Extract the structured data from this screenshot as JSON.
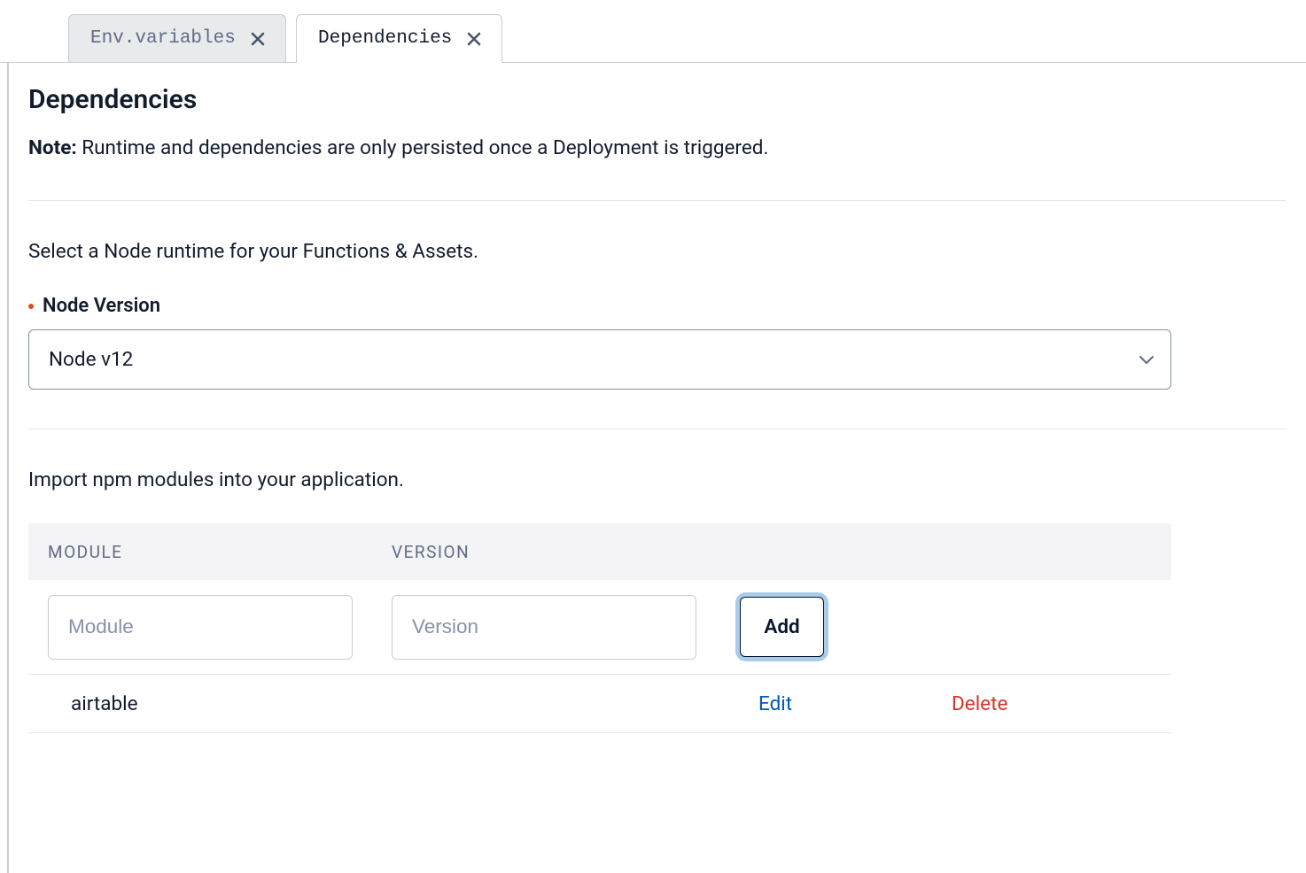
{
  "tabs": [
    {
      "label": "Env.variables",
      "active": false
    },
    {
      "label": "Dependencies",
      "active": true
    }
  ],
  "page": {
    "heading": "Dependencies",
    "note_label": "Note:",
    "note_text": "Runtime and dependencies are only persisted once a Deployment is triggered.",
    "runtime_lead": "Select a Node runtime for your Functions & Assets.",
    "node_version_label": "Node Version",
    "node_version_value": "Node v12",
    "npm_lead": "Import npm modules into your application."
  },
  "table": {
    "head": {
      "module": "MODULE",
      "version": "VERSION"
    },
    "inputs": {
      "module_placeholder": "Module",
      "version_placeholder": "Version",
      "add_label": "Add"
    },
    "rows": [
      {
        "module": "airtable",
        "version": "",
        "edit_label": "Edit",
        "delete_label": "Delete"
      }
    ]
  }
}
